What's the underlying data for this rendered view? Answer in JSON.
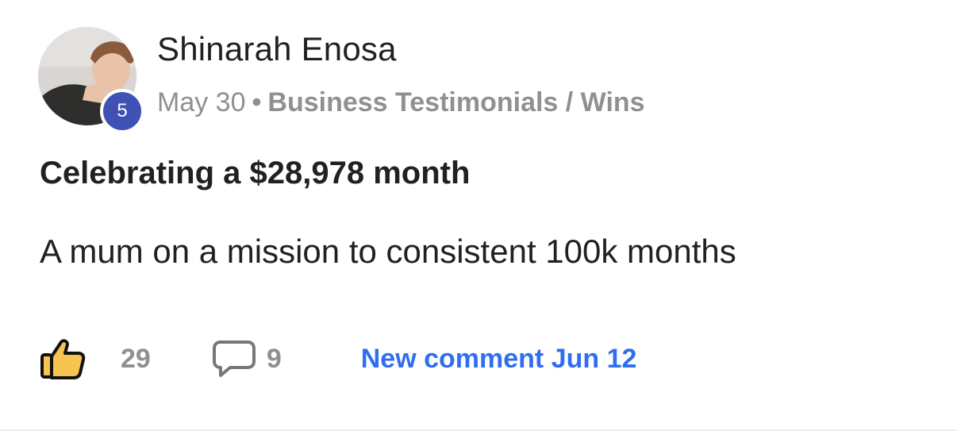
{
  "post": {
    "author": {
      "name": "Shinarah Enosa",
      "level": "5"
    },
    "date": "May 30",
    "separator": "•",
    "category": "Business Testimonials / Wins",
    "title": "Celebrating a $28,978 month",
    "body": "A mum on a mission to consistent 100k months",
    "likes": "29",
    "comments": "9",
    "last_comment": "New comment Jun 12"
  },
  "icons": {
    "like": "thumbs-up-icon",
    "comment": "speech-bubble-icon"
  },
  "colors": {
    "level_badge": "#3f51b5",
    "link": "#2f6ef0",
    "like_fill": "#f5c451",
    "meta_text": "#909090",
    "primary_text": "#202124"
  }
}
